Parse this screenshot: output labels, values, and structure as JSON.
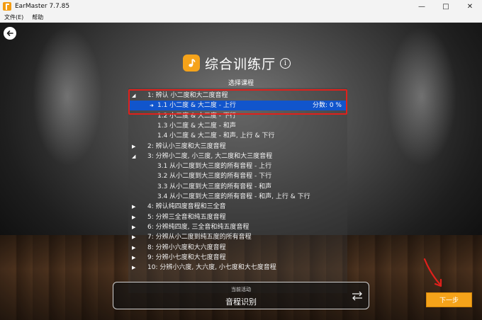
{
  "window": {
    "title": "EarMaster 7.7.85"
  },
  "menu": {
    "file": "文件(E)",
    "help": "帮助"
  },
  "header": {
    "title": "综合训练厅",
    "info": "i"
  },
  "subtitle": "选择课程",
  "tree": [
    {
      "label": "1: 辨认 小二度和大二度音程",
      "expanded": true
    },
    {
      "label": "1.1 小二度 & 大二度 - 上行",
      "score": "分数: 0 %",
      "selected": true
    },
    {
      "label": "1.2 小二度 & 大二度 - 下行"
    },
    {
      "label": "1.3 小二度 & 大二度 - 和声"
    },
    {
      "label": "1.4 小二度 & 大二度 - 和声, 上行 & 下行"
    },
    {
      "label": "2: 辨认小三度和大三度音程",
      "expanded": false
    },
    {
      "label": "3: 分辨小二度, 小三度, 大二度和大三度音程",
      "expanded": true
    },
    {
      "label": "3.1 从小二度到大三度的所有音程 - 上行"
    },
    {
      "label": "3.2 从小二度到大三度的所有音程 - 下行"
    },
    {
      "label": "3.3 从小二度到大三度的所有音程 - 和声"
    },
    {
      "label": "3.4 从小二度到大三度的所有音程 - 和声, 上行 & 下行"
    },
    {
      "label": "4: 辨认纯四度音程和三全音",
      "expanded": false
    },
    {
      "label": "5: 分辨三全音和纯五度音程",
      "expanded": false
    },
    {
      "label": "6: 分辨纯四度, 三全音和纯五度音程",
      "expanded": false
    },
    {
      "label": "7: 分辨从小二度到纯五度的所有音程",
      "expanded": false
    },
    {
      "label": "8: 分辨小六度和大六度音程",
      "expanded": false
    },
    {
      "label": "9: 分辨小七度和大七度音程",
      "expanded": false
    },
    {
      "label": "10: 分辨小六度, 大六度, 小七度和大七度音程",
      "expanded": false
    }
  ],
  "activity": {
    "label": "当前活动",
    "value": "音程识别"
  },
  "next_button": "下一步",
  "colors": {
    "accent": "#f5a31a",
    "selection": "#1155cc",
    "annotation": "#e0201b"
  }
}
